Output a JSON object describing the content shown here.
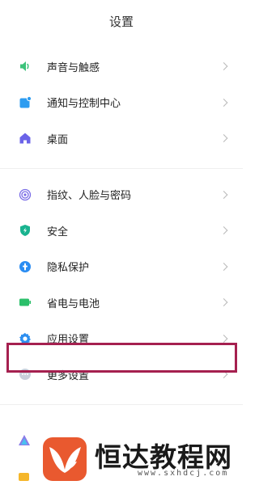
{
  "header": {
    "title": "设置"
  },
  "groups": [
    {
      "items": [
        {
          "label": "声音与触感",
          "icon": "speaker-icon",
          "color": "#3cc37a"
        },
        {
          "label": "通知与控制中心",
          "icon": "notification-icon",
          "color": "#2d9cf0"
        },
        {
          "label": "桌面",
          "icon": "home-icon",
          "color": "#6b63e8"
        }
      ]
    },
    {
      "items": [
        {
          "label": "指纹、人脸与密码",
          "icon": "fingerprint-icon",
          "color": "#7a6de6"
        },
        {
          "label": "安全",
          "icon": "shield-icon",
          "color": "#19b38f"
        },
        {
          "label": "隐私保护",
          "icon": "privacy-icon",
          "color": "#2a8cf2"
        },
        {
          "label": "省电与电池",
          "icon": "battery-icon",
          "color": "#2bbf6a"
        },
        {
          "label": "应用设置",
          "icon": "gear-icon",
          "color": "#2d8ff0"
        },
        {
          "label": "更多设置",
          "icon": "more-icon",
          "color": "#8a93a6"
        }
      ]
    }
  ],
  "watermark": {
    "text": "恒达教程网",
    "url": "www.sxhdcj.com",
    "color": "#e9592f"
  }
}
